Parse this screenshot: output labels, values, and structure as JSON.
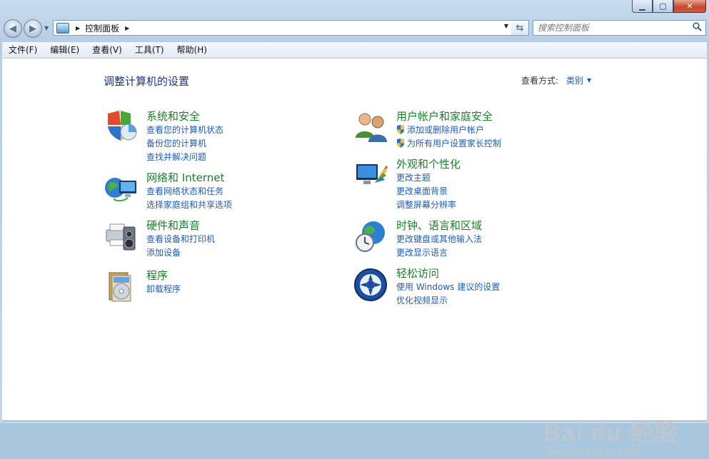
{
  "window": {
    "caption_buttons": [
      {
        "name": "minimize-button",
        "glyph": "▁"
      },
      {
        "name": "maximize-button",
        "glyph": "▢"
      },
      {
        "name": "close-button",
        "glyph": "✕"
      }
    ]
  },
  "address_bar": {
    "breadcrumb": "控制面板",
    "icon": "control-panel-icon"
  },
  "search": {
    "placeholder": "搜索控制面板",
    "icon": "search-icon"
  },
  "menu": [
    "文件(F)",
    "编辑(E)",
    "查看(V)",
    "工具(T)",
    "帮助(H)"
  ],
  "main": {
    "title": "调整计算机的设置",
    "view_by_label": "查看方式:",
    "view_by_value": "类别"
  },
  "categories": [
    {
      "title": "系统和安全",
      "icon": "system-security-icon",
      "links": [
        "查看您的计算机状态",
        "备份您的计算机",
        "查找并解决问题"
      ]
    },
    {
      "title": "网络和 Internet",
      "icon": "network-internet-icon",
      "links": [
        "查看网络状态和任务",
        "选择家庭组和共享选项"
      ]
    },
    {
      "title": "硬件和声音",
      "icon": "hardware-sound-icon",
      "links": [
        "查看设备和打印机",
        "添加设备"
      ]
    },
    {
      "title": "程序",
      "icon": "programs-icon",
      "links": [
        "卸载程序"
      ]
    },
    {
      "title": "用户帐户和家庭安全",
      "icon": "user-accounts-icon",
      "links": [
        "添加或删除用户帐户",
        "为所有用户设置家长控制"
      ]
    },
    {
      "title": "外观和个性化",
      "icon": "appearance-icon",
      "links": [
        "更改主题",
        "更改桌面背景",
        "调整屏幕分辨率"
      ]
    },
    {
      "title": "时钟、语言和区域",
      "icon": "clock-language-icon",
      "links": [
        "更改键盘或其他输入法",
        "更改显示语言"
      ]
    },
    {
      "title": "轻松访问",
      "icon": "ease-of-access-icon",
      "links": [
        "使用 Windows 建议的设置",
        "优化视频显示"
      ]
    }
  ],
  "watermark": {
    "brand": "Bai du 经验",
    "url": "jingyan.baidu.com"
  }
}
